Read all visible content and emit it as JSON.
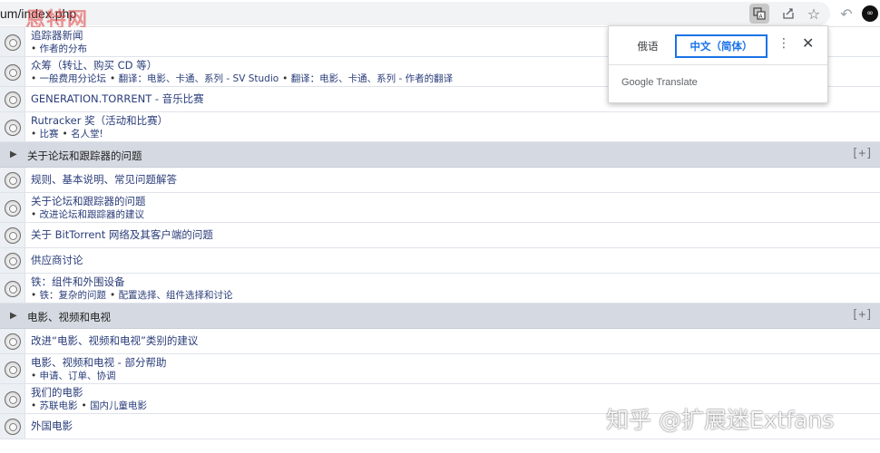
{
  "browser": {
    "url": "um/index.php",
    "watermark_text": "恩特网",
    "translate_icon": "translate-icon",
    "share_icon": "share-icon",
    "star_icon": "star-icon",
    "back_icon": "back-icon",
    "extension_icon": "extension-icon"
  },
  "translate_popup": {
    "tabs": [
      "俄语",
      "中文（简体）"
    ],
    "active_tab": "中文（简体）",
    "brand": "Google Translate"
  },
  "forum": {
    "rows": [
      {
        "type": "forum",
        "title": "追踪器新闻",
        "subs": [
          "作者的分布"
        ]
      },
      {
        "type": "forum",
        "title": "众筹（转让、购买 CD 等）",
        "subs": [
          "一般费用分论坛",
          "翻译：电影、卡通、系列 - SV Studio",
          "翻译：电影、卡通、系列 - 作者的翻译"
        ]
      },
      {
        "type": "forum",
        "title": "GENERATION.TORRENT - 音乐比赛",
        "subs": []
      },
      {
        "type": "forum",
        "title": "Rutracker 奖（活动和比赛）",
        "subs": [
          "比赛",
          "名人堂!"
        ]
      },
      {
        "type": "category",
        "title": "关于论坛和跟踪器的问题",
        "expand": "[+]"
      },
      {
        "type": "forum",
        "title": "规则、基本说明、常见问题解答",
        "subs": []
      },
      {
        "type": "forum",
        "title": "关于论坛和跟踪器的问题",
        "subs": [
          "改进论坛和跟踪器的建议"
        ]
      },
      {
        "type": "forum",
        "title": "关于 BitTorrent 网络及其客户端的问题",
        "subs": []
      },
      {
        "type": "forum",
        "title": "供应商讨论",
        "subs": []
      },
      {
        "type": "forum",
        "title": "铁：组件和外围设备",
        "subs": [
          "铁：复杂的问题",
          "配置选择、组件选择和讨论"
        ]
      },
      {
        "type": "category",
        "title": "电影、视频和电视",
        "expand": "[+]"
      },
      {
        "type": "forum",
        "title": "改进“电影、视频和电视”类别的建议",
        "subs": []
      },
      {
        "type": "forum",
        "title": "电影、视频和电视 - 部分帮助",
        "subs": [
          "申请、订单、协调"
        ]
      },
      {
        "type": "forum",
        "title": "我们的电影",
        "subs": [
          "苏联电影",
          "国内儿童电影"
        ]
      },
      {
        "type": "forum",
        "title": "外国电影",
        "subs": []
      }
    ]
  },
  "overlay_watermark": "知乎 @扩展迷Extfans"
}
